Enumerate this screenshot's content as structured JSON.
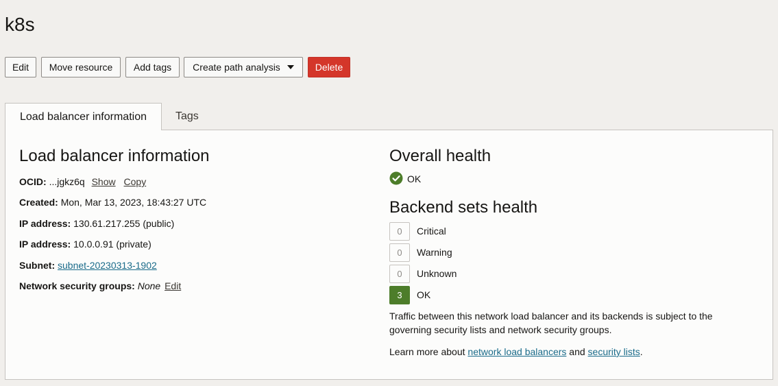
{
  "page": {
    "title": "k8s"
  },
  "toolbar": {
    "edit": "Edit",
    "move": "Move resource",
    "add_tags": "Add tags",
    "path_analysis": "Create path analysis",
    "delete": "Delete"
  },
  "tabs": [
    {
      "label": "Load balancer information"
    },
    {
      "label": "Tags"
    }
  ],
  "info": {
    "heading": "Load balancer information",
    "ocid_label": "OCID:",
    "ocid_value": "...jgkz6q",
    "show": "Show",
    "copy": "Copy",
    "created_label": "Created:",
    "created_value": "Mon, Mar 13, 2023, 18:43:27 UTC",
    "ip_label": "IP address:",
    "ip_public": "130.61.217.255 (public)",
    "ip_private": "10.0.0.91 (private)",
    "subnet_label": "Subnet:",
    "subnet_value": "subnet-20230313-1902",
    "nsg_label": "Network security groups:",
    "nsg_value": "None",
    "nsg_edit": "Edit"
  },
  "health": {
    "overall_heading": "Overall health",
    "overall_status": "OK",
    "backend_heading": "Backend sets health",
    "items": [
      {
        "count": "0",
        "label": "Critical"
      },
      {
        "count": "0",
        "label": "Warning"
      },
      {
        "count": "0",
        "label": "Unknown"
      },
      {
        "count": "3",
        "label": "OK"
      }
    ],
    "traffic_text": "Traffic between this network load balancer and its backends is subject to the governing security lists and network security groups.",
    "learn_prefix": "Learn more about",
    "learn_link1": "network load balancers",
    "learn_and": "and",
    "learn_link2": "security lists",
    "learn_suffix": "."
  },
  "colors": {
    "delete_button": "#d4362a",
    "ok_green": "#4d7d2a",
    "link": "#1a6b8a"
  },
  "icons": {
    "overall_status_icon": "check-circle-icon",
    "path_analysis_icon": "caret-down-icon"
  }
}
